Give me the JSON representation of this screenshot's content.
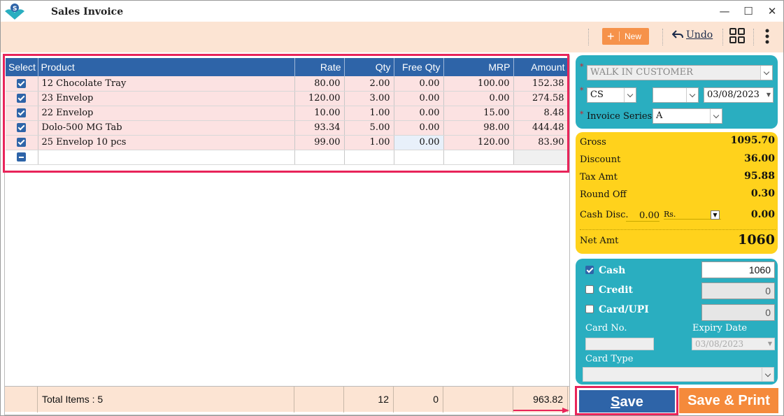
{
  "window": {
    "title": "Sales Invoice",
    "minimize": "—",
    "maximize": "☐",
    "close": "✕"
  },
  "toolbar": {
    "new_label": "New",
    "undo_label": "Undo"
  },
  "grid": {
    "columns": [
      "Select",
      "Product",
      "Rate",
      "Qty",
      "Free Qty",
      "MRP",
      "Amount"
    ],
    "rows": [
      {
        "product": "12 Chocolate Tray",
        "rate": "80.00",
        "qty": "2.00",
        "free_qty": "0.00",
        "mrp": "100.00",
        "amount": "152.38"
      },
      {
        "product": "23 Envelop",
        "rate": "120.00",
        "qty": "3.00",
        "free_qty": "0.00",
        "mrp": "0.00",
        "amount": "274.58"
      },
      {
        "product": "22 Envelop",
        "rate": "10.00",
        "qty": "1.00",
        "free_qty": "0.00",
        "mrp": "15.00",
        "amount": "8.48"
      },
      {
        "product": "Dolo-500 MG Tab",
        "rate": "93.34",
        "qty": "5.00",
        "free_qty": "0.00",
        "mrp": "98.00",
        "amount": "444.48"
      },
      {
        "product": "25 Envelop 10 pcs",
        "rate": "99.00",
        "qty": "1.00",
        "free_qty": "0.00",
        "mrp": "120.00",
        "amount": "83.90"
      }
    ]
  },
  "footer": {
    "total_items": "Total Items : 5",
    "qty_total": "12",
    "free_qty_total": "0",
    "amount_total": "963.82"
  },
  "customer": {
    "name": "WALK IN CUSTOMER",
    "type": "CS",
    "extra": "",
    "date": "03/08/2023",
    "invoice_series_label": "Invoice Series",
    "invoice_series": "A"
  },
  "summary": {
    "gross_label": "Gross",
    "gross": "1095.70",
    "discount_label": "Discount",
    "discount": "36.00",
    "tax_label": "Tax Amt",
    "tax": "95.88",
    "round_label": "Round Off",
    "round": "0.30",
    "cash_disc_label": "Cash Disc.",
    "cash_disc_input": "0.00",
    "cash_disc_unit": "Rs.",
    "cash_disc": "0.00",
    "net_label": "Net Amt",
    "net": "1060"
  },
  "payment": {
    "cash_label": "Cash",
    "cash": "1060",
    "credit_label": "Credit",
    "credit": "0",
    "card_label": "Card/UPI",
    "card": "0",
    "card_no_label": "Card No.",
    "card_no": "",
    "expiry_label": "Expiry Date",
    "expiry": "03/08/2023",
    "card_type_label": "Card Type",
    "card_type": ""
  },
  "actions": {
    "save_underlined": "S",
    "save_rest": "ave",
    "save_print": "Save & Print"
  },
  "colors": {
    "header_blue": "#2e64a8",
    "row_pink": "#fce2e2",
    "toolbar_peach": "#fce4d3",
    "panel_teal": "#2aaec0",
    "panel_yellow": "#ffd21c",
    "accent_orange": "#f58a3b",
    "highlight_red": "#e8245a"
  }
}
